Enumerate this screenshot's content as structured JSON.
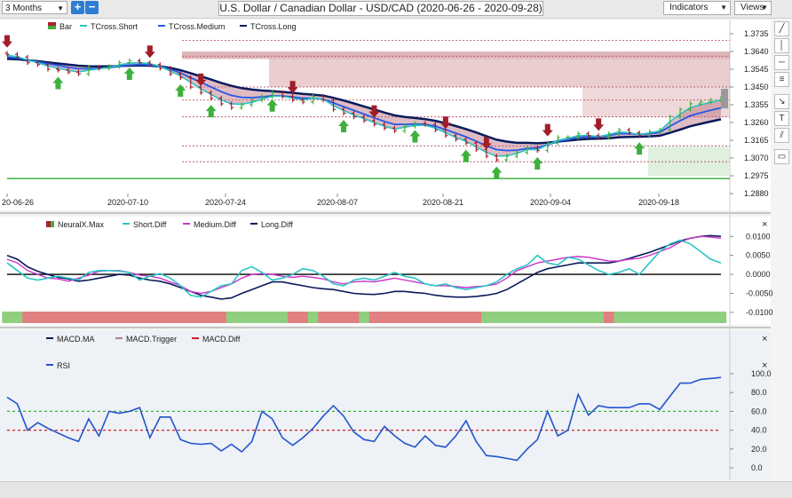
{
  "toolbar": {
    "range": "3 Months",
    "plus": "+",
    "minus": "−",
    "title": "U.S. Dollar / Canadian Dollar - USD/CAD (2020-06-26 - 2020-09-28)",
    "indicators": "Indicators",
    "views": "Views"
  },
  "side_tools": [
    "line-tool-icon",
    "vertical-line-icon",
    "horizontal-line-icon",
    "fibonacci-icon",
    "arrow-tool-icon",
    "text-tool-icon",
    "channel-tool-icon",
    "grid-tool-icon",
    "comment-icon"
  ],
  "colors": {
    "up": "#3db03d",
    "down": "#a01d2a",
    "short": "#2bc4c4",
    "medium": "#2557e8",
    "long": "#0a1a5c",
    "rsi": "#2255cc"
  },
  "chart_data": [
    {
      "type": "line",
      "panel": "price",
      "legend": [
        "Bar",
        "TCross.Short",
        "TCross.Medium",
        "TCross.Long"
      ],
      "x_ticks": [
        "20-06-26",
        "2020-07-10",
        "2020-07-24",
        "2020-08-07",
        "2020-08-21",
        "2020-09-04",
        "2020-09-18"
      ],
      "y_ticks": [
        "1.3735",
        "1.3640",
        "1.3545",
        "1.3450",
        "1.3355",
        "1.3260",
        "1.3165",
        "1.3070",
        "1.2975",
        "1.2880"
      ],
      "ylim": [
        1.288,
        1.3735
      ],
      "close": [
        1.3625,
        1.361,
        1.358,
        1.357,
        1.3545,
        1.354,
        1.353,
        1.352,
        1.3555,
        1.355,
        1.356,
        1.358,
        1.359,
        1.358,
        1.357,
        1.355,
        1.352,
        1.35,
        1.345,
        1.342,
        1.339,
        1.336,
        1.334,
        1.3355,
        1.338,
        1.34,
        1.342,
        1.34,
        1.338,
        1.337,
        1.34,
        1.338,
        1.333,
        1.331,
        1.329,
        1.327,
        1.325,
        1.323,
        1.3215,
        1.324,
        1.3255,
        1.325,
        1.322,
        1.319,
        1.317,
        1.315,
        1.3115,
        1.308,
        1.306,
        1.308,
        1.31,
        1.3125,
        1.311,
        1.315,
        1.318,
        1.318,
        1.32,
        1.319,
        1.318,
        1.32,
        1.322,
        1.3205,
        1.319,
        1.321,
        1.322,
        1.329,
        1.333,
        1.336,
        1.337,
        1.338,
        1.339
      ],
      "tcross_short": [
        1.362,
        1.3612,
        1.3595,
        1.358,
        1.3562,
        1.355,
        1.354,
        1.353,
        1.354,
        1.3548,
        1.3555,
        1.3568,
        1.3578,
        1.358,
        1.3575,
        1.356,
        1.3535,
        1.351,
        1.3475,
        1.344,
        1.341,
        1.338,
        1.336,
        1.3358,
        1.3368,
        1.3385,
        1.34,
        1.34,
        1.339,
        1.338,
        1.339,
        1.3385,
        1.335,
        1.3325,
        1.33,
        1.328,
        1.326,
        1.324,
        1.3225,
        1.3235,
        1.3245,
        1.3245,
        1.323,
        1.3205,
        1.318,
        1.316,
        1.313,
        1.31,
        1.308,
        1.3082,
        1.3095,
        1.3115,
        1.3115,
        1.314,
        1.3165,
        1.3175,
        1.319,
        1.319,
        1.3185,
        1.3195,
        1.321,
        1.3205,
        1.3195,
        1.3205,
        1.3215,
        1.3265,
        1.3305,
        1.334,
        1.3355,
        1.3368,
        1.338
      ],
      "tcross_medium": [
        1.361,
        1.3605,
        1.3595,
        1.3585,
        1.3575,
        1.3565,
        1.3555,
        1.3548,
        1.3548,
        1.355,
        1.3553,
        1.356,
        1.3567,
        1.357,
        1.3568,
        1.356,
        1.3545,
        1.3525,
        1.35,
        1.3475,
        1.345,
        1.3425,
        1.3405,
        1.3395,
        1.3393,
        1.3397,
        1.3403,
        1.3402,
        1.3397,
        1.339,
        1.339,
        1.3385,
        1.3365,
        1.3345,
        1.3325,
        1.3305,
        1.3285,
        1.3265,
        1.325,
        1.325,
        1.3252,
        1.325,
        1.324,
        1.3222,
        1.3203,
        1.3183,
        1.316,
        1.3135,
        1.3115,
        1.311,
        1.3112,
        1.3122,
        1.3125,
        1.314,
        1.3158,
        1.3168,
        1.318,
        1.3183,
        1.3183,
        1.319,
        1.32,
        1.32,
        1.3197,
        1.32,
        1.3207,
        1.324,
        1.327,
        1.3296,
        1.3312,
        1.3326,
        1.3338
      ],
      "tcross_long": [
        1.36,
        1.3598,
        1.3593,
        1.3588,
        1.3582,
        1.3576,
        1.357,
        1.3564,
        1.3561,
        1.356,
        1.356,
        1.3562,
        1.3564,
        1.3565,
        1.3564,
        1.356,
        1.3552,
        1.354,
        1.3524,
        1.3507,
        1.349,
        1.3472,
        1.3456,
        1.3444,
        1.3436,
        1.3431,
        1.3428,
        1.3424,
        1.3419,
        1.3413,
        1.3409,
        1.3404,
        1.3392,
        1.3378,
        1.3362,
        1.3346,
        1.333,
        1.3313,
        1.3298,
        1.329,
        1.3284,
        1.3278,
        1.3269,
        1.3256,
        1.3241,
        1.3225,
        1.3207,
        1.3187,
        1.3168,
        1.3158,
        1.3151,
        1.3151,
        1.3149,
        1.3152,
        1.3158,
        1.3163,
        1.3169,
        1.3172,
        1.3173,
        1.3176,
        1.3181,
        1.3183,
        1.3184,
        1.3186,
        1.3189,
        1.3205,
        1.3222,
        1.324,
        1.3253,
        1.3265,
        1.3277
      ]
    },
    {
      "type": "line",
      "panel": "neuralx",
      "legend": [
        "NeuralX.Max",
        "Short.Diff",
        "Medium.Diff",
        "Long.Diff"
      ],
      "y_ticks": [
        "0.0100",
        "0.0050",
        "0.0000",
        "-0.0050",
        "-0.0100"
      ],
      "ylim": [
        -0.0105,
        0.011
      ],
      "short_diff": [
        0.003,
        0.001,
        -0.001,
        -0.0015,
        -0.001,
        -0.0005,
        -0.001,
        -0.0015,
        0.0005,
        0.001,
        0.001,
        0.0008,
        0.0005,
        -0.0015,
        -0.0005,
        0.0002,
        -0.001,
        -0.003,
        -0.0055,
        -0.006,
        -0.0045,
        -0.003,
        -0.0025,
        0.001,
        0.002,
        0.0005,
        -0.0015,
        -0.001,
        0.0,
        0.0015,
        0.001,
        -0.0005,
        -0.0025,
        -0.003,
        -0.0015,
        -0.001,
        -0.0015,
        -0.0005,
        0.0005,
        -0.0005,
        -0.001,
        -0.0025,
        -0.003,
        -0.0025,
        -0.0035,
        -0.004,
        -0.0035,
        -0.003,
        -0.002,
        0.0,
        0.0015,
        0.0025,
        0.005,
        0.003,
        0.0025,
        0.0045,
        0.004,
        0.0025,
        0.001,
        0.0,
        0.0005,
        0.0015,
        0.0,
        0.003,
        0.006,
        0.008,
        0.009,
        0.008,
        0.006,
        0.004,
        0.003
      ],
      "medium_diff": [
        0.004,
        0.003,
        0.001,
        0.0,
        -0.001,
        -0.0012,
        -0.0018,
        -0.001,
        -0.0002,
        0.0008,
        0.001,
        0.001,
        0.0005,
        -0.0002,
        -0.0005,
        -0.001,
        -0.002,
        -0.003,
        -0.0045,
        -0.005,
        -0.0045,
        -0.0035,
        -0.0025,
        -0.001,
        0.0,
        0.0002,
        0.0,
        -0.0005,
        -0.0008,
        -0.0005,
        -0.0008,
        -0.0012,
        -0.002,
        -0.0025,
        -0.002,
        -0.0018,
        -0.002,
        -0.0015,
        -0.001,
        -0.0015,
        -0.002,
        -0.0025,
        -0.003,
        -0.003,
        -0.0032,
        -0.0035,
        -0.0032,
        -0.003,
        -0.0025,
        -0.001,
        0.001,
        0.002,
        0.003,
        0.0035,
        0.004,
        0.0045,
        0.0047,
        0.0045,
        0.004,
        0.0035,
        0.0035,
        0.004,
        0.0042,
        0.005,
        0.006,
        0.007,
        0.0085,
        0.0095,
        0.01,
        0.0098,
        0.0095
      ],
      "long_diff": [
        0.005,
        0.004,
        0.002,
        0.0008,
        0.0,
        -0.0008,
        -0.0012,
        -0.0018,
        -0.0015,
        -0.001,
        -0.0005,
        0.0,
        -0.0002,
        -0.001,
        -0.0015,
        -0.0018,
        -0.0025,
        -0.0035,
        -0.0045,
        -0.0055,
        -0.006,
        -0.0065,
        -0.0062,
        -0.005,
        -0.004,
        -0.003,
        -0.002,
        -0.002,
        -0.0025,
        -0.003,
        -0.0035,
        -0.0038,
        -0.004,
        -0.0045,
        -0.005,
        -0.0052,
        -0.0053,
        -0.005,
        -0.0045,
        -0.0045,
        -0.0048,
        -0.005,
        -0.0055,
        -0.0058,
        -0.006,
        -0.006,
        -0.0058,
        -0.0055,
        -0.005,
        -0.004,
        -0.0025,
        -0.001,
        0.0005,
        0.0015,
        0.002,
        0.0025,
        0.003,
        0.003,
        0.003,
        0.003,
        0.0035,
        0.0042,
        0.005,
        0.0058,
        0.0068,
        0.0078,
        0.0088,
        0.0095,
        0.01,
        0.0102,
        0.01
      ],
      "neuralx_max": [
        1,
        1,
        -1,
        -1,
        -1,
        -1,
        -1,
        -1,
        -1,
        -1,
        -1,
        -1,
        -1,
        -1,
        -1,
        -1,
        -1,
        -1,
        -1,
        -1,
        -1,
        -1,
        1,
        1,
        1,
        1,
        1,
        1,
        -1,
        -1,
        1,
        -1,
        -1,
        -1,
        -1,
        1,
        -1,
        -1,
        -1,
        -1,
        -1,
        -1,
        -1,
        -1,
        -1,
        -1,
        -1,
        1,
        1,
        1,
        1,
        1,
        1,
        1,
        1,
        1,
        1,
        1,
        1,
        -1,
        1,
        1,
        1,
        1,
        1,
        1,
        1,
        1,
        1,
        1,
        1
      ]
    },
    {
      "type": "line",
      "panel": "oscillator",
      "legend": [
        "MACD.MA",
        "MACD.Trigger",
        "MACD.Diff",
        "RSI"
      ],
      "y_ticks": [
        "100.0",
        "80.0",
        "60.0",
        "40.0",
        "20.0",
        "0.0"
      ],
      "ylim": [
        0,
        100
      ],
      "levels": [
        60,
        40
      ],
      "rsi": [
        75,
        68,
        40,
        48,
        42,
        37,
        32,
        28,
        52,
        34,
        60,
        58,
        60,
        64,
        32,
        54,
        54,
        30,
        26,
        25,
        26,
        18,
        25,
        17,
        28,
        60,
        52,
        32,
        24,
        32,
        42,
        55,
        66,
        55,
        38,
        30,
        28,
        44,
        34,
        26,
        22,
        34,
        24,
        22,
        34,
        50,
        28,
        13,
        12,
        10,
        8,
        20,
        30,
        60,
        34,
        40,
        78,
        56,
        66,
        64,
        64,
        64,
        68,
        68,
        62,
        76,
        90,
        90,
        94,
        95,
        96
      ]
    }
  ]
}
